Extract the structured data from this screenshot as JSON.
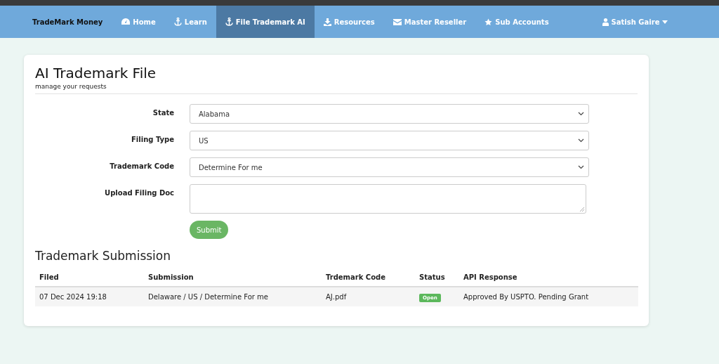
{
  "brand": "TradeMark Money",
  "nav": [
    {
      "label": "Home",
      "selected": false
    },
    {
      "label": "Learn",
      "selected": false
    },
    {
      "label": "File Trademark AI",
      "selected": true
    },
    {
      "label": "Resources",
      "selected": false
    },
    {
      "label": "Master Reseller",
      "selected": false
    },
    {
      "label": "Sub Accounts",
      "selected": false
    }
  ],
  "user": {
    "name": "Satish Gaire"
  },
  "page": {
    "title": "AI Trademark File",
    "subtitle": "manage your requests"
  },
  "form": {
    "fields": [
      {
        "label": "State",
        "kind": "select",
        "value": "Alabama"
      },
      {
        "label": "Filing Type",
        "kind": "select",
        "value": "US"
      },
      {
        "label": "Trademark Code",
        "kind": "select",
        "value": "Determine For me"
      },
      {
        "label": "Upload Filing Doc",
        "kind": "textarea"
      }
    ],
    "submit": "Submit"
  },
  "table": {
    "title": "Trademark Submission",
    "columns": [
      "Filed",
      "Submission",
      "Trdemark Code",
      "Status",
      "API Response"
    ],
    "rows": [
      {
        "filed": "07 Dec 2024 19:18",
        "submission": "Delaware / US / Determine For me",
        "code": "AJ.pdf",
        "status": "Open",
        "response": "Approved By USPTO. Pending Grant"
      }
    ]
  }
}
